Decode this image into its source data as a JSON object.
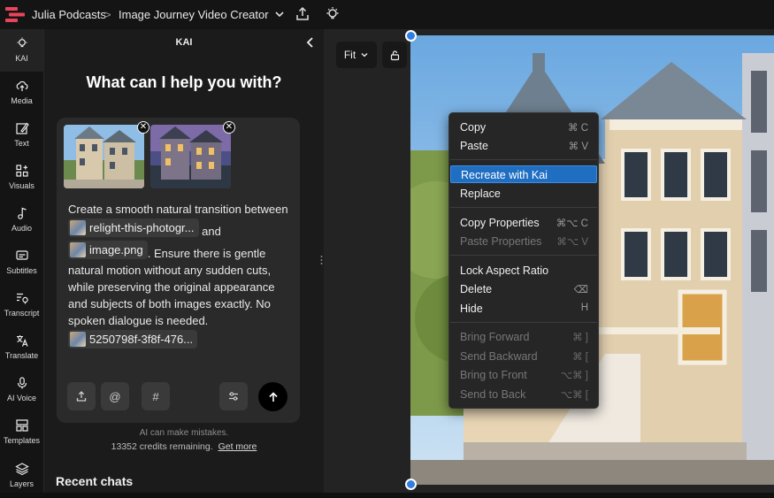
{
  "topbar": {
    "workspace": "Julia Podcasts",
    "separator": ">",
    "project": "Image Journey Video Creator"
  },
  "rail": [
    {
      "label": "KAI",
      "icon": "bulb-icon"
    },
    {
      "label": "Media",
      "icon": "upload-cloud-icon"
    },
    {
      "label": "Text",
      "icon": "text-edit-icon"
    },
    {
      "label": "Visuals",
      "icon": "shapes-plus-icon"
    },
    {
      "label": "Audio",
      "icon": "music-note-icon"
    },
    {
      "label": "Subtitles",
      "icon": "subtitles-icon"
    },
    {
      "label": "Transcript",
      "icon": "transcript-icon"
    },
    {
      "label": "Translate",
      "icon": "translate-icon"
    },
    {
      "label": "AI Voice",
      "icon": "microphone-icon"
    },
    {
      "label": "Templates",
      "icon": "templates-icon"
    },
    {
      "label": "Layers",
      "icon": "layers-icon"
    }
  ],
  "kai": {
    "title": "KAI",
    "headline": "What can I help you with?",
    "prompt_part1": "Create a smooth natural transition between",
    "chip1": "relight-this-photogr...",
    "prompt_and": "and",
    "chip2": "image.png",
    "prompt_part2": ". Ensure there is gentle natural motion without any sudden cuts, while preserving the original appearance and subjects of both images exactly. No spoken dialogue is needed.",
    "chip3": "5250798f-3f8f-476...",
    "tool_at": "@",
    "tool_hash": "#",
    "disclaimer": "AI can make mistakes.",
    "credits": "13352 credits remaining.",
    "get_more": "Get more",
    "recent_chats": "Recent chats"
  },
  "canvas": {
    "zoom_label": "Fit"
  },
  "context_menu": {
    "items": [
      {
        "label": "Copy",
        "shortcut": "⌘ C",
        "disabled": false
      },
      {
        "label": "Paste",
        "shortcut": "⌘ V",
        "disabled": false
      },
      {
        "label": "Recreate with Kai",
        "shortcut": "",
        "disabled": false,
        "highlighted": true
      },
      {
        "label": "Replace",
        "shortcut": "",
        "disabled": false
      },
      {
        "label": "Copy Properties",
        "shortcut": "⌘⌥ C",
        "disabled": false
      },
      {
        "label": "Paste Properties",
        "shortcut": "⌘⌥ V",
        "disabled": true
      },
      {
        "label": "Lock Aspect Ratio",
        "shortcut": "",
        "disabled": false
      },
      {
        "label": "Delete",
        "shortcut": "⌫",
        "disabled": false
      },
      {
        "label": "Hide",
        "shortcut": "H",
        "disabled": false
      },
      {
        "label": "Bring Forward",
        "shortcut": "⌘ ]",
        "disabled": true
      },
      {
        "label": "Send Backward",
        "shortcut": "⌘ [",
        "disabled": true
      },
      {
        "label": "Bring to Front",
        "shortcut": "⌥⌘ ]",
        "disabled": true
      },
      {
        "label": "Send to Back",
        "shortcut": "⌥⌘ [",
        "disabled": true
      }
    ]
  },
  "colors": {
    "accent": "#1f6ec2",
    "handle": "#2f7fe0",
    "panel": "#1b1b1b",
    "card": "#2a2a2a"
  }
}
